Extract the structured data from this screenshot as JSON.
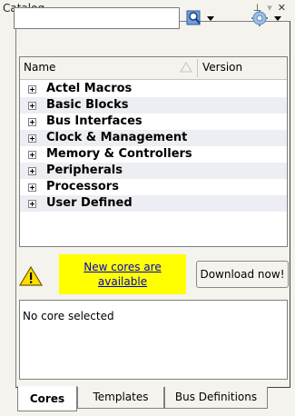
{
  "window": {
    "title": "Catalog",
    "controls": [
      {
        "name": "pin-icon",
        "glyph": "⊥"
      },
      {
        "name": "dropdown-icon",
        "glyph": "▾"
      },
      {
        "name": "close-icon",
        "glyph": "✕"
      }
    ]
  },
  "search": {
    "value": "",
    "placeholder": "",
    "search_icon": "magnifier-icon",
    "options_icon": "gear-icon"
  },
  "table": {
    "columns": [
      "Name",
      "Version"
    ],
    "rows": [
      {
        "label": "Actel Macros"
      },
      {
        "label": "Basic Blocks"
      },
      {
        "label": "Bus Interfaces"
      },
      {
        "label": "Clock & Management"
      },
      {
        "label": "Memory & Controllers"
      },
      {
        "label": "Peripherals"
      },
      {
        "label": "Processors"
      },
      {
        "label": "User Defined"
      }
    ]
  },
  "notice": {
    "link_text": "New cores are available",
    "button_label": "Download now!",
    "accent_color": "#ffff00"
  },
  "description": {
    "text": "No core selected"
  },
  "tabs": [
    {
      "label": "Cores",
      "active": true
    },
    {
      "label": "Templates",
      "active": false
    },
    {
      "label": "Bus Definitions",
      "active": false
    }
  ]
}
